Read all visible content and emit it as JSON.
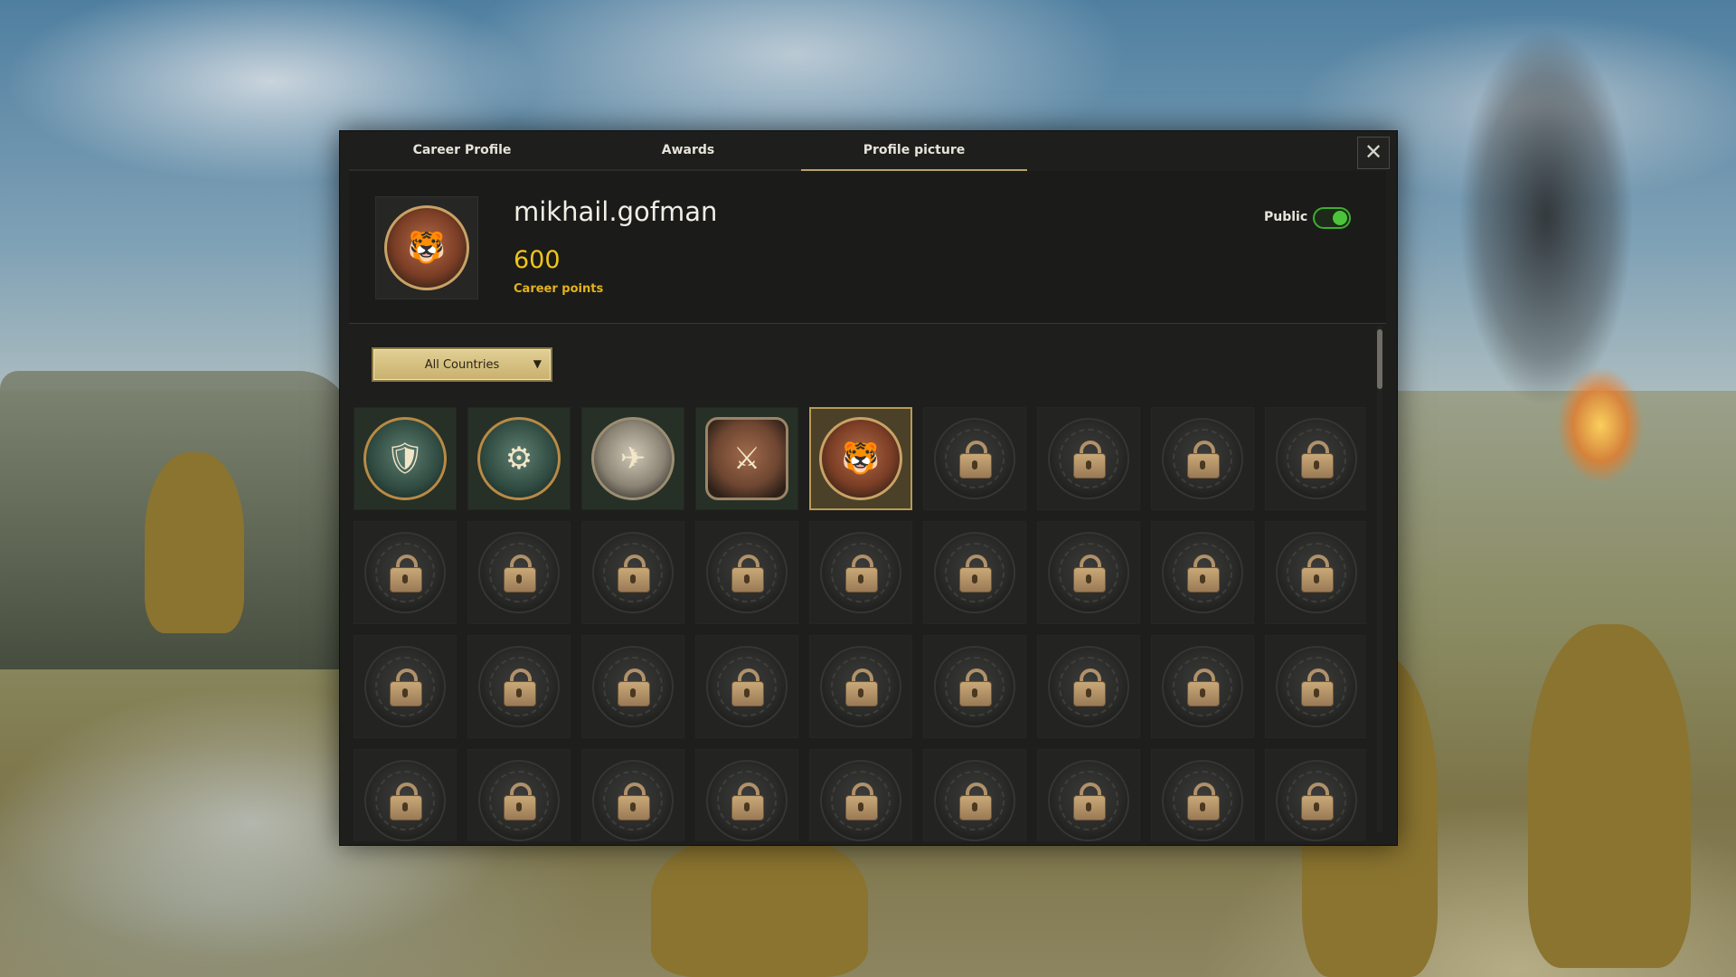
{
  "tabs": [
    {
      "label": "Career Profile"
    },
    {
      "label": "Awards"
    },
    {
      "label": "Profile picture"
    }
  ],
  "active_tab": "Profile picture",
  "close_icon": "close-icon",
  "profile": {
    "username": "mikhail.gofman",
    "points": "600",
    "points_label": "Career points",
    "public_label": "Public",
    "public_enabled": true
  },
  "filter": {
    "selected": "All Countries"
  },
  "picture_grid": {
    "rows": 4,
    "columns": 9,
    "selected_index": 4,
    "items": [
      {
        "icon": "tank-medal-icon",
        "state": "unlocked"
      },
      {
        "icon": "tank-gear-medal-icon",
        "state": "unlocked"
      },
      {
        "icon": "winged-plane-medal-icon",
        "state": "unlocked"
      },
      {
        "icon": "winged-shield-medal-icon",
        "state": "unlocked"
      },
      {
        "icon": "tiger-medal-icon",
        "state": "unlocked"
      },
      {
        "icon": "padlock-icon",
        "state": "locked"
      },
      {
        "icon": "padlock-icon",
        "state": "locked"
      },
      {
        "icon": "padlock-icon",
        "state": "locked"
      },
      {
        "icon": "padlock-icon",
        "state": "locked"
      },
      {
        "icon": "padlock-icon",
        "state": "locked"
      },
      {
        "icon": "padlock-icon",
        "state": "locked"
      },
      {
        "icon": "padlock-icon",
        "state": "locked"
      },
      {
        "icon": "padlock-icon",
        "state": "locked"
      },
      {
        "icon": "padlock-icon",
        "state": "locked"
      },
      {
        "icon": "padlock-icon",
        "state": "locked"
      },
      {
        "icon": "padlock-icon",
        "state": "locked"
      },
      {
        "icon": "padlock-icon",
        "state": "locked"
      },
      {
        "icon": "padlock-icon",
        "state": "locked"
      },
      {
        "icon": "padlock-icon",
        "state": "locked"
      },
      {
        "icon": "padlock-icon",
        "state": "locked"
      },
      {
        "icon": "padlock-icon",
        "state": "locked"
      },
      {
        "icon": "padlock-icon",
        "state": "locked"
      },
      {
        "icon": "padlock-icon",
        "state": "locked"
      },
      {
        "icon": "padlock-icon",
        "state": "locked"
      },
      {
        "icon": "padlock-icon",
        "state": "locked"
      },
      {
        "icon": "padlock-icon",
        "state": "locked"
      },
      {
        "icon": "padlock-icon",
        "state": "locked"
      },
      {
        "icon": "padlock-icon",
        "state": "locked"
      },
      {
        "icon": "padlock-icon",
        "state": "locked"
      },
      {
        "icon": "padlock-icon",
        "state": "locked"
      },
      {
        "icon": "padlock-icon",
        "state": "locked"
      },
      {
        "icon": "padlock-icon",
        "state": "locked"
      },
      {
        "icon": "padlock-icon",
        "state": "locked"
      },
      {
        "icon": "padlock-icon",
        "state": "locked"
      },
      {
        "icon": "padlock-icon",
        "state": "locked"
      },
      {
        "icon": "padlock-icon",
        "state": "locked"
      }
    ]
  },
  "colors": {
    "accent_gold": "#f0c419",
    "toggle_green": "#4cc43a",
    "tab_underline": "#b7a26a"
  }
}
